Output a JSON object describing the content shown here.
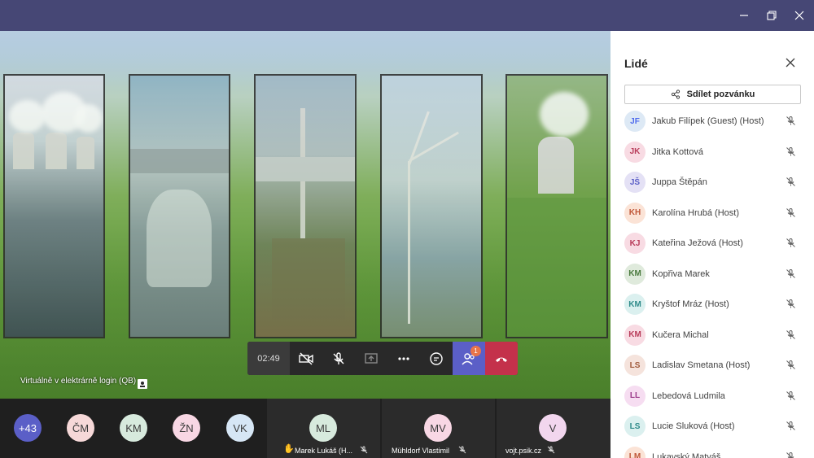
{
  "window": {
    "controls": [
      "minimize-icon",
      "restore-icon",
      "close-icon"
    ]
  },
  "meeting": {
    "title": "Virtuálně v elektrárně login (QB)",
    "timer": "02:49",
    "people_badge": "1"
  },
  "call_controls": {
    "icons": [
      "camera-off-icon",
      "mic-off-icon",
      "share-tray-icon",
      "more-options-icon",
      "chat-icon",
      "people-icon",
      "hang-up-icon"
    ]
  },
  "strip": {
    "overflow_count": "+43",
    "small_avatars": [
      {
        "initials": "ČM",
        "color": "#f6d8d8"
      },
      {
        "initials": "KM",
        "color": "#d7eadd"
      },
      {
        "initials": "ŽN",
        "color": "#f8d7e4"
      },
      {
        "initials": "VK",
        "color": "#d6e6f5"
      }
    ],
    "tiles": [
      {
        "initials": "ML",
        "name": "Marek Lukáš (H...",
        "color": "#d7eadd",
        "hand_raised": true
      },
      {
        "initials": "MV",
        "name": "Mühldorf Vlastimil",
        "color": "#f8d7e4",
        "hand_raised": false
      },
      {
        "initials": "V",
        "name": "vojt.psik.cz",
        "color": "#f2d6ee",
        "hand_raised": false
      }
    ]
  },
  "sidebar": {
    "title": "Lidé",
    "share_label": "Sdílet pozvánku",
    "people": [
      {
        "initials": "JF",
        "name": "Jakub Filípek (Guest) (Host)",
        "bg": "#dde9f5",
        "fg": "#4f6bed"
      },
      {
        "initials": "JK",
        "name": "Jitka Kottová",
        "bg": "#f8dbe3",
        "fg": "#b83c5a"
      },
      {
        "initials": "JŠ",
        "name": "Juppa Štěpán",
        "bg": "#e4e1f5",
        "fg": "#5b5fc7"
      },
      {
        "initials": "KH",
        "name": "Karolína Hrubá (Host)",
        "bg": "#fbe3d6",
        "fg": "#c0583a"
      },
      {
        "initials": "KJ",
        "name": "Kateřina Ježová (Host)",
        "bg": "#f8dbe3",
        "fg": "#b83c5a"
      },
      {
        "initials": "KM",
        "name": "Kopřiva Marek",
        "bg": "#dfeadc",
        "fg": "#4a7a3e"
      },
      {
        "initials": "KM",
        "name": "Kryštof Mráz (Host)",
        "bg": "#dbf0ef",
        "fg": "#2f8b8a"
      },
      {
        "initials": "KM",
        "name": "Kučera Michal",
        "bg": "#f8dbe3",
        "fg": "#b83c5a"
      },
      {
        "initials": "LS",
        "name": "Ladislav Smetana (Host)",
        "bg": "#f5e3dc",
        "fg": "#a05a3c"
      },
      {
        "initials": "LL",
        "name": "Lebedová Ludmila",
        "bg": "#f6ddf1",
        "fg": "#9b3c8a"
      },
      {
        "initials": "LS",
        "name": "Lucie Sluková (Host)",
        "bg": "#dbf0ef",
        "fg": "#2f8b8a"
      },
      {
        "initials": "LM",
        "name": "Lukavský Matyáš",
        "bg": "#fbe3d6",
        "fg": "#c0583a"
      }
    ]
  }
}
